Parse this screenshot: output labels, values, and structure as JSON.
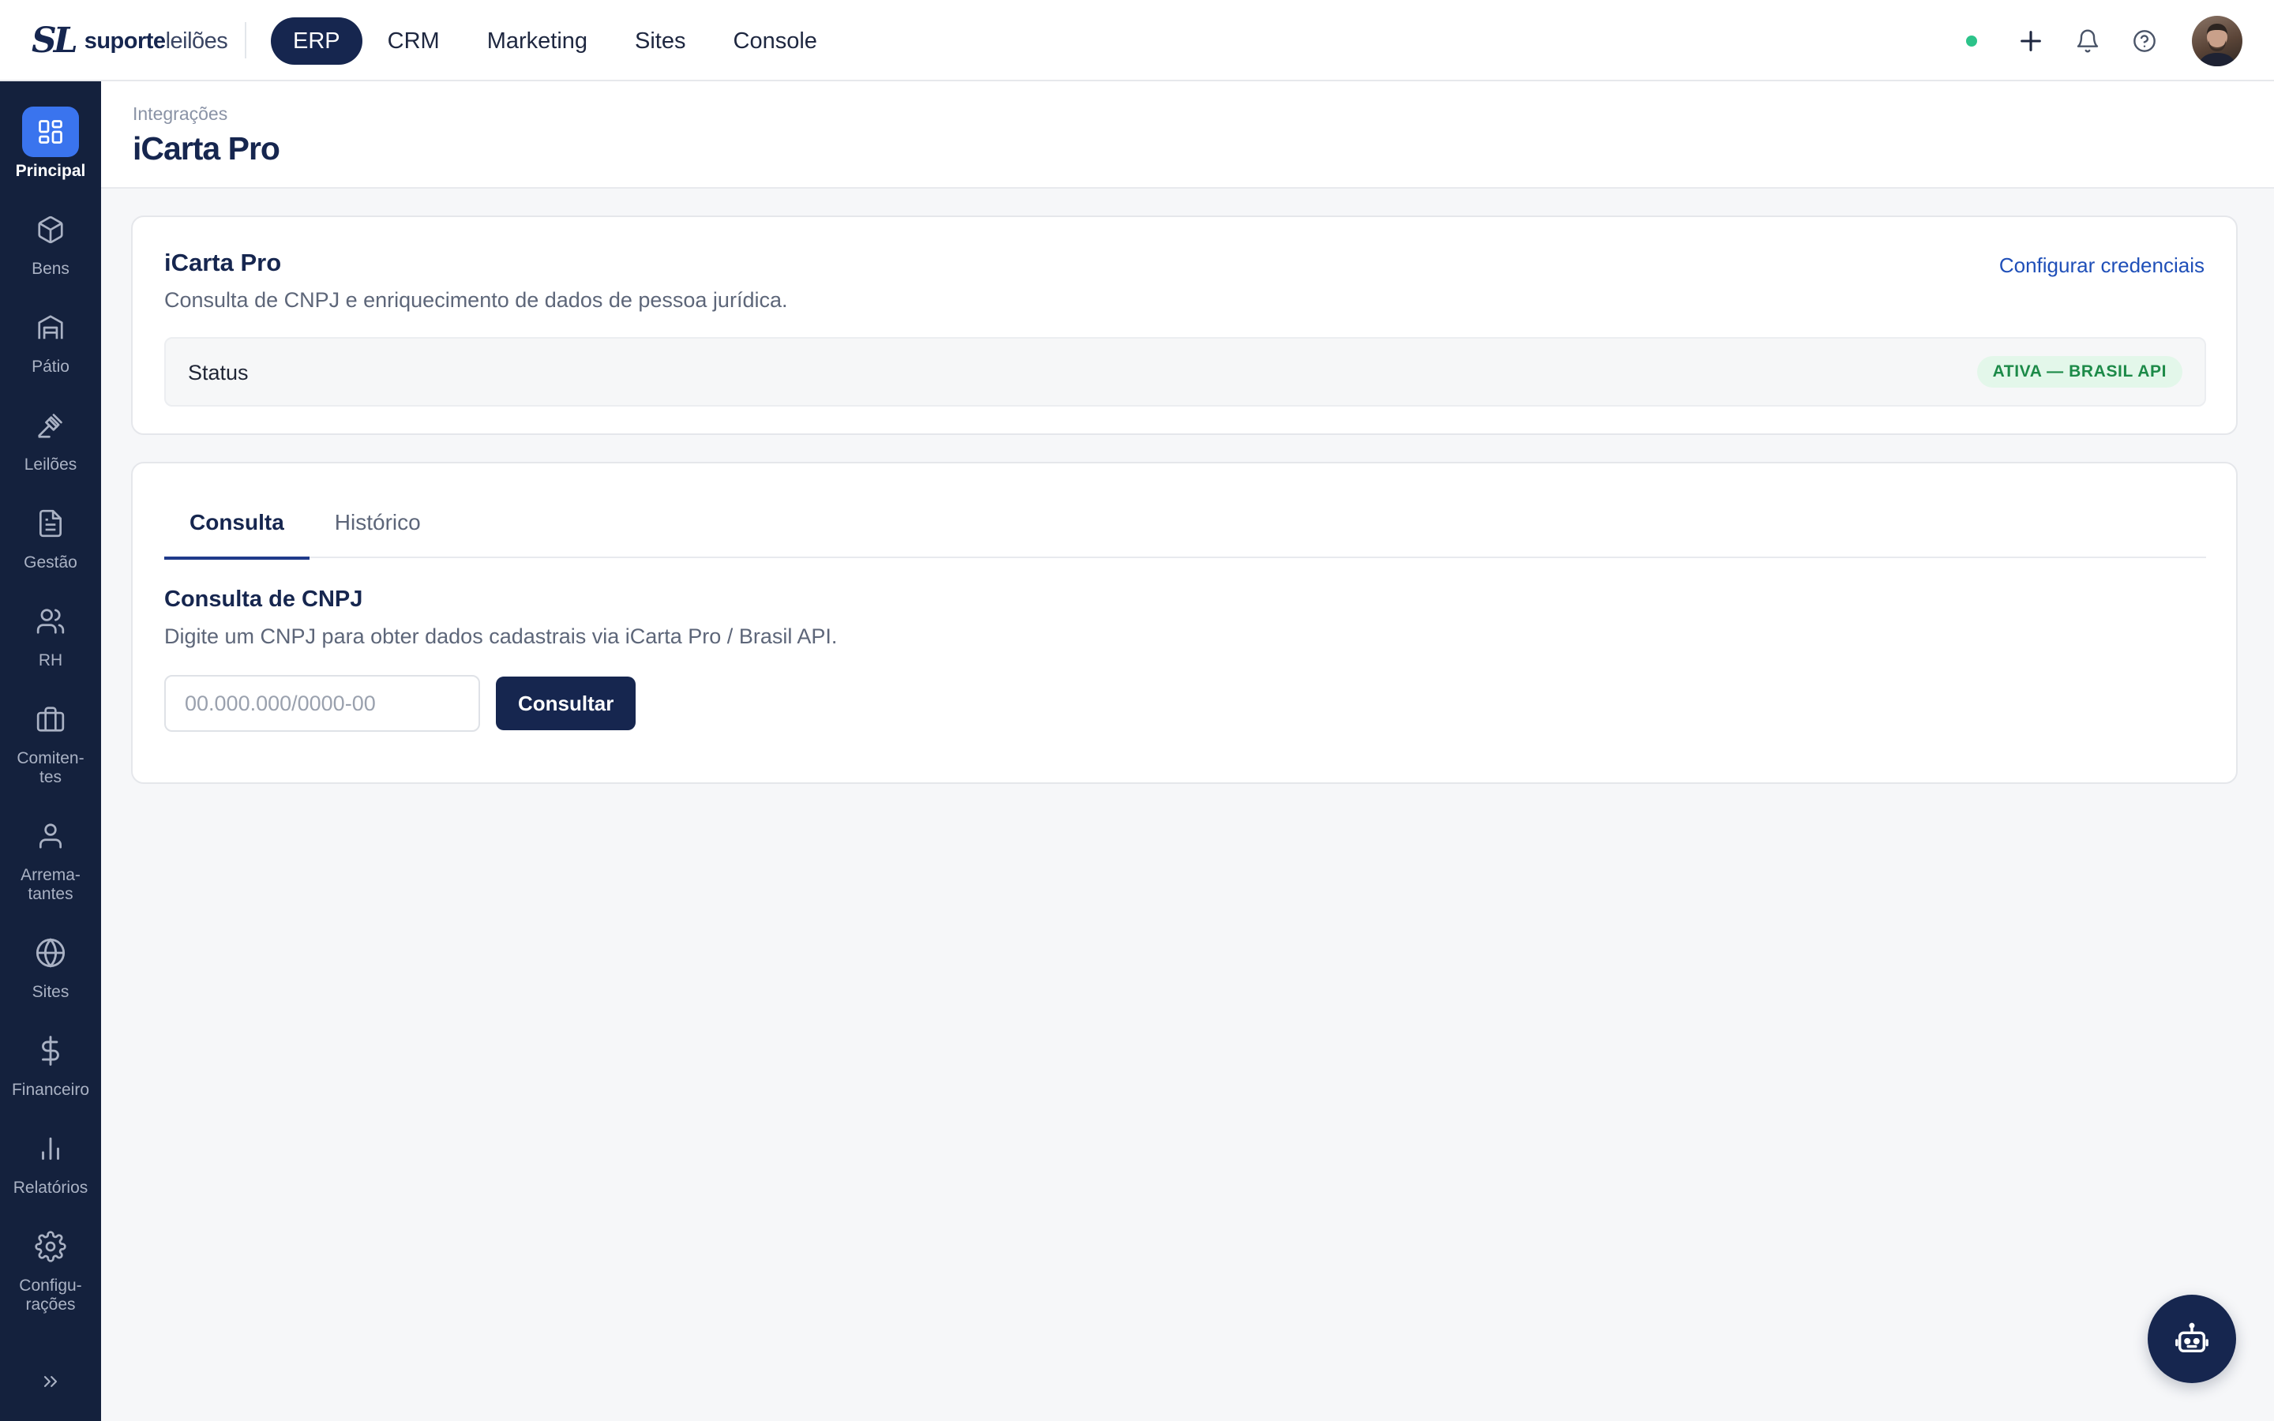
{
  "brand": {
    "mark": "SL",
    "name_bold": "suporte",
    "name_light": "leilões"
  },
  "top_nav": [
    {
      "label": "ERP",
      "active": true
    },
    {
      "label": "CRM",
      "active": false
    },
    {
      "label": "Marketing",
      "active": false
    },
    {
      "label": "Sites",
      "active": false
    },
    {
      "label": "Console",
      "active": false
    }
  ],
  "top_actions": {
    "status_color": "#2cc38a",
    "icons": [
      "plus-icon",
      "bell-icon",
      "help-circle-icon"
    ]
  },
  "sidebar": {
    "items": [
      {
        "label": "Principal",
        "icon": "grid-icon",
        "active": true
      },
      {
        "label": "Bens",
        "icon": "box-icon",
        "active": false
      },
      {
        "label": "Pátio",
        "icon": "warehouse-icon",
        "active": false
      },
      {
        "label": "Leilões",
        "icon": "gavel-icon",
        "active": false
      },
      {
        "label": "Gestão",
        "icon": "document-icon",
        "active": false
      },
      {
        "label": "RH",
        "icon": "users-icon",
        "active": false
      },
      {
        "label": "Comiten-",
        "label2": "tes",
        "icon": "briefcase-icon",
        "active": false
      },
      {
        "label": "Arrema-",
        "label2": "tantes",
        "icon": "user-icon",
        "active": false
      },
      {
        "label": "Sites",
        "icon": "globe-icon",
        "active": false
      },
      {
        "label": "Financeiro",
        "icon": "dollar-icon",
        "active": false
      },
      {
        "label": "Relatórios",
        "icon": "bar-chart-icon",
        "active": false
      },
      {
        "label": "Configu-",
        "label2": "rações",
        "icon": "gear-icon",
        "active": false
      }
    ],
    "collapse_icon": "chevrons-right-icon"
  },
  "header": {
    "breadcrumb": "Integrações",
    "title": "iCarta Pro"
  },
  "integration": {
    "title": "iCarta Pro",
    "description": "Consulta de CNPJ e enriquecimento de dados de pessoa jurídica.",
    "config_link": "Configurar credenciais",
    "status_label": "Status",
    "status_badge": "ATIVA — BRASIL API"
  },
  "tabs": [
    {
      "label": "Consulta",
      "active": true
    },
    {
      "label": "Histórico",
      "active": false
    }
  ],
  "consulta": {
    "title": "Consulta de CNPJ",
    "description": "Digite um CNPJ para obter dados cadastrais via iCarta Pro / Brasil API.",
    "input_placeholder": "00.000.000/0000-00",
    "input_value": "",
    "button_label": "Consultar"
  },
  "fab": {
    "icon": "robot-icon"
  },
  "colors": {
    "brand": "#16264f",
    "sidebar": "#14213d",
    "accent": "#3a74ee",
    "success": "#1c8a48"
  }
}
